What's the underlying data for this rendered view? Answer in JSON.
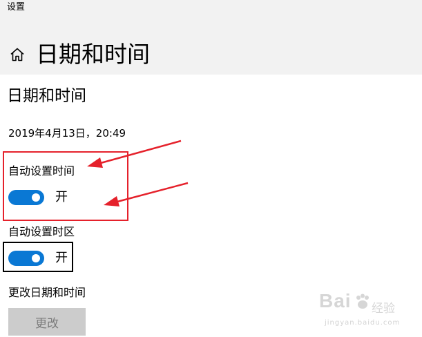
{
  "window": {
    "title": "设置"
  },
  "header": {
    "title": "日期和时间",
    "home_icon": "home-icon"
  },
  "section": {
    "title": "日期和时间"
  },
  "current_datetime": "2019年4月13日，20:49",
  "settings": {
    "auto_time": {
      "label": "自动设置时间",
      "state": "开",
      "on": true
    },
    "auto_timezone": {
      "label": "自动设置时区",
      "state": "开",
      "on": true
    }
  },
  "change_datetime": {
    "label": "更改日期和时间",
    "button_label": "更改"
  },
  "annotations": {
    "red_color": "#e5212b",
    "black_color": "#000000",
    "arrow_icon": "red-arrow"
  },
  "colors": {
    "accent": "#0a78d4",
    "header_bg": "#f2f2f2",
    "disabled_button_bg": "#cccccc"
  },
  "watermark": {
    "brand": "Bai",
    "product": "经验",
    "url": "jingyan.baidu.com"
  }
}
